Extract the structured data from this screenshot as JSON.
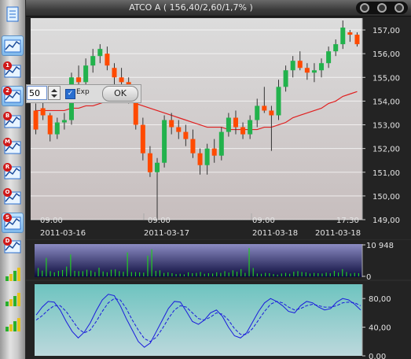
{
  "window": {
    "title": "ATCO A ( 156,40/2,60/1,7% )"
  },
  "toolbar": {
    "buttons": [
      {
        "name": "notes-button",
        "icon": "notepad-icon",
        "badge": "",
        "selected": false
      },
      {
        "name": "chart-type-button",
        "icon": "chart-icon",
        "badge": "",
        "selected": true
      },
      {
        "name": "indicator-1-button",
        "icon": "chart-icon",
        "badge": "1",
        "selected": false
      },
      {
        "name": "indicator-2-button",
        "icon": "chart-icon",
        "badge": "2",
        "selected": true
      },
      {
        "name": "indicator-b-button",
        "icon": "chart-icon",
        "badge": "B",
        "selected": false
      },
      {
        "name": "indicator-m-button",
        "icon": "chart-icon",
        "badge": "M",
        "selected": false
      },
      {
        "name": "indicator-r-button",
        "icon": "chart-icon",
        "badge": "R",
        "selected": false
      },
      {
        "name": "indicator-o-button",
        "icon": "chart-icon",
        "badge": "O",
        "selected": false
      },
      {
        "name": "indicator-s-button",
        "icon": "chart-icon",
        "badge": "S",
        "selected": true
      },
      {
        "name": "indicator-d-button",
        "icon": "chart-icon",
        "badge": "D",
        "selected": false
      },
      {
        "name": "volume-bars-button-1",
        "icon": "bars-icon",
        "badge": "",
        "selected": false
      },
      {
        "name": "volume-bars-button-2",
        "icon": "bars-icon",
        "badge": "",
        "selected": false
      },
      {
        "name": "volume-bars-button-3",
        "icon": "bars-icon",
        "badge": "",
        "selected": false
      }
    ]
  },
  "overlay": {
    "period_value": "50",
    "exp_checked": true,
    "exp_label": "Exp",
    "ok_label": "OK"
  },
  "colors": {
    "up_candle": "#22b24c",
    "down_candle": "#ff4a00",
    "moving_average": "#e02020",
    "volume_bar": "#22cc22",
    "oscillator": "#1a1adc"
  },
  "chart_data": [
    {
      "type": "candlestick",
      "ylim": [
        149,
        157.5
      ],
      "y_ticks": [
        "157,00",
        "156,00",
        "155,00",
        "154,00",
        "153,00",
        "152,00",
        "151,00",
        "150,00",
        "149,00"
      ],
      "x_time_labels": [
        "09:00",
        "09:00",
        "09:00",
        "17:30"
      ],
      "x_date_labels": [
        "2011-03-16",
        "2011-03-17",
        "2011-03-18",
        "2011-03-18"
      ],
      "candles": [
        [
          153.6,
          153.9,
          152.6,
          152.8
        ],
        [
          153.7,
          154.2,
          153.2,
          153.4
        ],
        [
          153.4,
          153.5,
          152.3,
          152.6
        ],
        [
          152.6,
          153.3,
          152.4,
          153.1
        ],
        [
          153.1,
          153.5,
          152.8,
          153.2
        ],
        [
          153.2,
          155.2,
          153.0,
          155.0
        ],
        [
          155.0,
          155.5,
          154.6,
          154.8
        ],
        [
          154.8,
          155.8,
          154.5,
          155.5
        ],
        [
          155.5,
          156.2,
          155.2,
          155.9
        ],
        [
          155.9,
          156.4,
          155.6,
          156.2
        ],
        [
          156.0,
          156.3,
          155.3,
          155.5
        ],
        [
          155.4,
          155.6,
          154.7,
          155.0
        ],
        [
          155.0,
          155.4,
          154.5,
          154.8
        ],
        [
          154.8,
          155.0,
          153.9,
          154.1
        ],
        [
          154.1,
          154.2,
          152.8,
          153.0
        ],
        [
          153.0,
          153.3,
          151.5,
          151.8
        ],
        [
          151.8,
          152.1,
          150.8,
          151.0
        ],
        [
          151.0,
          151.6,
          149.0,
          151.4
        ],
        [
          151.4,
          153.4,
          151.2,
          153.2
        ],
        [
          153.2,
          153.5,
          152.6,
          152.9
        ],
        [
          152.9,
          153.2,
          152.4,
          152.7
        ],
        [
          152.7,
          153.0,
          152.1,
          152.4
        ],
        [
          152.4,
          152.8,
          151.6,
          151.8
        ],
        [
          151.8,
          152.0,
          150.9,
          151.3
        ],
        [
          151.3,
          152.2,
          150.9,
          152.0
        ],
        [
          152.0,
          152.4,
          151.4,
          151.7
        ],
        [
          151.7,
          152.9,
          151.5,
          152.7
        ],
        [
          152.7,
          153.5,
          152.5,
          153.3
        ],
        [
          153.3,
          153.6,
          152.6,
          152.9
        ],
        [
          152.9,
          153.1,
          152.4,
          152.6
        ],
        [
          152.6,
          153.4,
          152.4,
          153.2
        ],
        [
          153.2,
          154.1,
          152.9,
          153.8
        ],
        [
          153.8,
          154.6,
          153.5,
          153.6
        ],
        [
          153.6,
          153.8,
          151.9,
          153.4
        ],
        [
          153.4,
          154.9,
          153.2,
          154.6
        ],
        [
          154.6,
          155.5,
          154.4,
          155.3
        ],
        [
          155.3,
          155.9,
          155.0,
          155.7
        ],
        [
          155.7,
          156.1,
          155.3,
          155.4
        ],
        [
          155.4,
          155.6,
          154.9,
          155.2
        ],
        [
          155.2,
          155.6,
          154.8,
          155.3
        ],
        [
          155.3,
          155.8,
          155.0,
          155.6
        ],
        [
          155.6,
          156.3,
          155.4,
          156.1
        ],
        [
          156.1,
          156.6,
          155.9,
          156.4
        ],
        [
          156.4,
          157.4,
          156.2,
          157.1
        ],
        [
          156.9,
          157.0,
          156.5,
          156.8
        ],
        [
          156.8,
          156.9,
          156.3,
          156.4
        ]
      ],
      "ma_series": {
        "name": "EMA",
        "values": [
          153.6,
          153.6,
          153.6,
          153.6,
          153.6,
          153.7,
          153.7,
          153.8,
          153.8,
          153.9,
          154.0,
          154.0,
          154.0,
          154.0,
          153.9,
          153.8,
          153.7,
          153.6,
          153.5,
          153.4,
          153.3,
          153.2,
          153.1,
          153.0,
          152.9,
          152.9,
          152.9,
          152.8,
          152.8,
          152.8,
          152.8,
          152.8,
          152.9,
          152.9,
          153.0,
          153.1,
          153.3,
          153.4,
          153.5,
          153.6,
          153.7,
          153.9,
          154.0,
          154.2,
          154.3,
          154.4
        ]
      }
    },
    {
      "type": "bar",
      "name": "volume",
      "y_ticks": [
        "10 948",
        "0"
      ],
      "ylim": [
        0,
        10948
      ],
      "values": [
        2900,
        2000,
        6400,
        1800,
        1400,
        1900,
        2200,
        3400,
        7600,
        1900,
        1800,
        1800,
        2300,
        2000,
        1500,
        3000,
        1700,
        1400,
        2300,
        2400,
        1800,
        1600,
        8300,
        1500,
        1500,
        1400,
        1300,
        7200,
        9400,
        1900,
        2100,
        1200,
        1400,
        1100,
        800,
        900,
        700,
        1400,
        1100,
        1200,
        1500,
        900,
        1100,
        1000,
        1400,
        1200,
        1800,
        1300,
        2100,
        1600,
        2500,
        1200,
        9800,
        2900,
        1000,
        900,
        1200,
        1100,
        800,
        600,
        1000,
        1200,
        900,
        1600,
        1800,
        1500,
        1400,
        1000,
        1200,
        1100,
        1000,
        1300,
        1100,
        1900,
        1300,
        2500,
        1500,
        1000,
        1200,
        1100
      ]
    },
    {
      "type": "line",
      "name": "oscillator",
      "y_ticks": [
        "80,00",
        "40,00",
        "0,00"
      ],
      "ylim": [
        0,
        100
      ],
      "series": [
        {
          "values": [
            57,
            68,
            76,
            75,
            64,
            48,
            34,
            25,
            33,
            46,
            63,
            78,
            86,
            84,
            70,
            52,
            36,
            20,
            12,
            18,
            34,
            50,
            66,
            76,
            75,
            62,
            48,
            44,
            50,
            60,
            64,
            55,
            40,
            28,
            25,
            32,
            47,
            62,
            74,
            80,
            76,
            70,
            62,
            60,
            70,
            76,
            74,
            68,
            64,
            66,
            75,
            80,
            78,
            72,
            64
          ]
        },
        {
          "values": [
            50,
            56,
            64,
            70,
            70,
            62,
            50,
            38,
            32,
            36,
            48,
            62,
            74,
            80,
            78,
            66,
            50,
            36,
            24,
            20,
            26,
            38,
            52,
            64,
            70,
            68,
            60,
            52,
            50,
            54,
            60,
            58,
            50,
            38,
            30,
            30,
            38,
            50,
            62,
            72,
            76,
            74,
            68,
            64,
            66,
            70,
            72,
            70,
            68,
            68,
            70,
            74,
            75,
            74,
            70
          ]
        }
      ]
    }
  ]
}
